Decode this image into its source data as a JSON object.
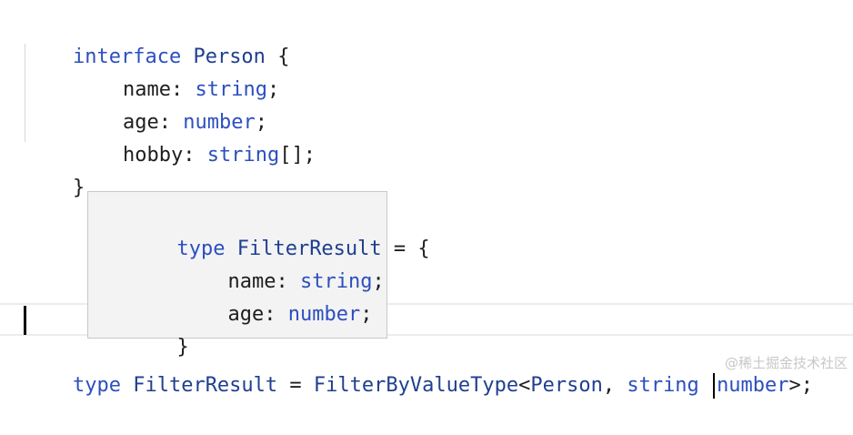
{
  "code": {
    "line1": {
      "kw": "interface",
      "name": "Person",
      "brace": "{"
    },
    "line2": {
      "prop": "name",
      "colon": ":",
      "type": "string",
      "end": ";"
    },
    "line3": {
      "prop": "age",
      "colon": ":",
      "type": "number",
      "end": ";"
    },
    "line4": {
      "prop": "hobby",
      "colon": ":",
      "type": "string",
      "suffix": "[];"
    },
    "line5": {
      "brace": "}"
    }
  },
  "tooltip": {
    "line1": {
      "kw": "type",
      "name": "FilterResult",
      "eq": "=",
      "brace": "{"
    },
    "line2": {
      "prop": "name",
      "colon": ":",
      "type": "string",
      "end": ";"
    },
    "line3": {
      "prop": "age",
      "colon": ":",
      "type": "number",
      "end": ";"
    },
    "line4": {
      "brace": "}"
    }
  },
  "bottom": {
    "kw": "type",
    "name": "FilterResult",
    "eq": "=",
    "fn": "FilterByValueType",
    "open": "<",
    "arg1": "Person",
    "comma": ",",
    "type1": "string",
    "pipe": "|",
    "type2": "number",
    "close": ">;"
  },
  "watermark": "@稀土掘金技术社区",
  "colors": {
    "keyword": "#2c4fbf",
    "identifier": "#1f3f8f",
    "text": "#1e1e1e",
    "tooltip_bg": "#f3f3f3"
  }
}
